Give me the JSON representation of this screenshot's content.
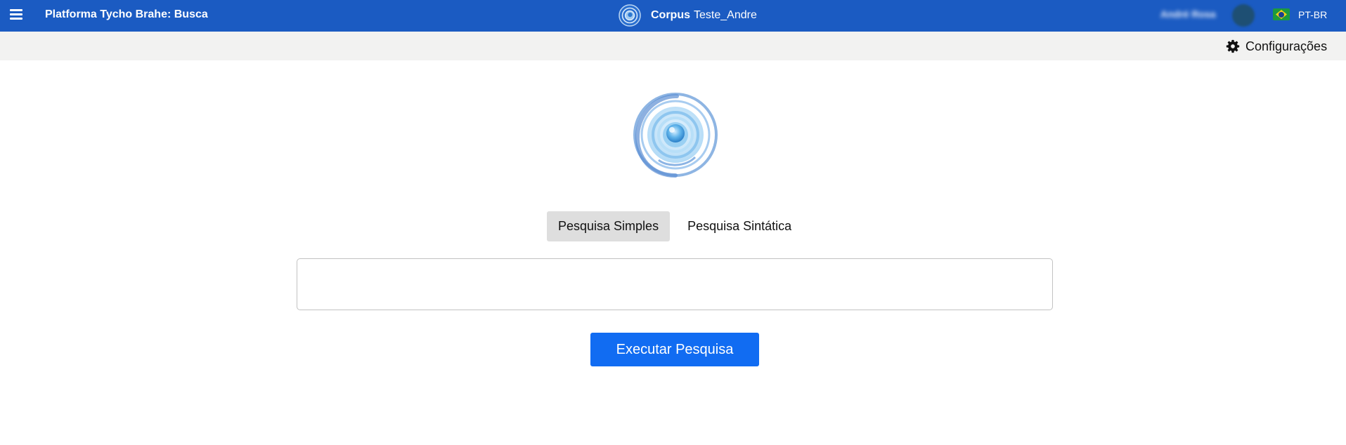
{
  "header": {
    "menu_icon": "hamburger-menu-icon",
    "app_title": "Platforma Tycho Brahe: Busca",
    "corpus_logo_icon": "spiral-logo-icon",
    "corpus_label": "Corpus",
    "corpus_name": "Teste_Andre",
    "user_name": "André Rosa",
    "avatar_icon": "user-avatar",
    "flag_icon": "brazil-flag-icon",
    "language": "PT-BR",
    "bg_color": "#1b5bc2"
  },
  "toolbar": {
    "settings_icon": "gear-icon",
    "settings_label": "Configurações"
  },
  "main": {
    "logo_icon": "tycho-brahe-spiral-logo",
    "tabs": [
      {
        "label": "Pesquisa Simples",
        "active": true
      },
      {
        "label": "Pesquisa Sintática",
        "active": false
      }
    ],
    "query": {
      "value": "",
      "placeholder": ""
    },
    "run_button_label": "Executar Pesquisa",
    "accent_color": "#116cf2"
  }
}
